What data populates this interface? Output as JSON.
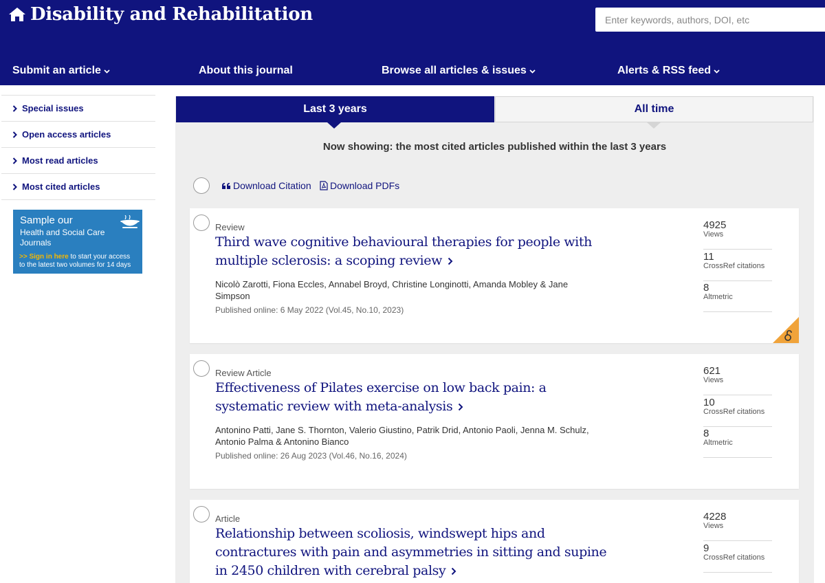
{
  "header": {
    "journal_title": "Disability and Rehabilitation",
    "search_placeholder": "Enter keywords, authors, DOI, etc",
    "nav": {
      "submit": "Submit an article",
      "about": "About this journal",
      "browse": "Browse all articles & issues",
      "alerts": "Alerts & RSS feed"
    }
  },
  "sidebar": {
    "items": [
      {
        "label": "Special issues"
      },
      {
        "label": "Open access articles"
      },
      {
        "label": "Most read articles"
      },
      {
        "label": "Most cited articles"
      }
    ],
    "promo": {
      "title": "Sample our",
      "subtitle_1": "Health and Social Care",
      "subtitle_2": "Journals",
      "prefix": ">> ",
      "link": "Sign in here",
      "text_1": " to start your access",
      "text_2": "to the latest two volumes for 14 days"
    }
  },
  "tabs": {
    "active": "Last 3 years",
    "inactive": "All time"
  },
  "showing_text": "Now showing: the most cited articles published within the last 3 years",
  "toolbar": {
    "download_citation": "Download Citation",
    "download_pdfs": "Download PDFs"
  },
  "articles": [
    {
      "type": "Review",
      "title": "Third wave cognitive behavioural therapies for people with multiple sclerosis: a scoping review",
      "authors": "Nicolò Zarotti, Fiona Eccles, Annabel Broyd, Christine Longinotti, Amanda Mobley & Jane Simpson",
      "published": "Published online: 6 May 2022 (Vol.45, No.10, 2023)",
      "views": "4925",
      "views_label": "Views",
      "crossref": "11",
      "crossref_label": "CrossRef citations",
      "altmetric": "8",
      "altmetric_label": "Altmetric",
      "open_access": true
    },
    {
      "type": "Review Article",
      "title": "Effectiveness of Pilates exercise on low back pain: a systematic review with meta-analysis",
      "authors": "Antonino Patti, Jane S. Thornton, Valerio Giustino, Patrik Drid, Antonio Paoli, Jenna M. Schulz, Antonio Palma & Antonino Bianco",
      "published": "Published online: 26 Aug 2023 (Vol.46, No.16, 2024)",
      "views": "621",
      "views_label": "Views",
      "crossref": "10",
      "crossref_label": "CrossRef citations",
      "altmetric": "8",
      "altmetric_label": "Altmetric",
      "open_access": false
    },
    {
      "type": "Article",
      "title": "Relationship between scoliosis, windswept hips and contractures with pain and asymmetries in sitting and supine in 2450 children with cerebral palsy",
      "views": "4228",
      "views_label": "Views",
      "crossref": "9",
      "crossref_label": "CrossRef citations"
    }
  ],
  "colors": {
    "brand_navy": "#10147e",
    "promo_blue": "#2a7fbf",
    "open_access_orange": "#f0a33a"
  }
}
